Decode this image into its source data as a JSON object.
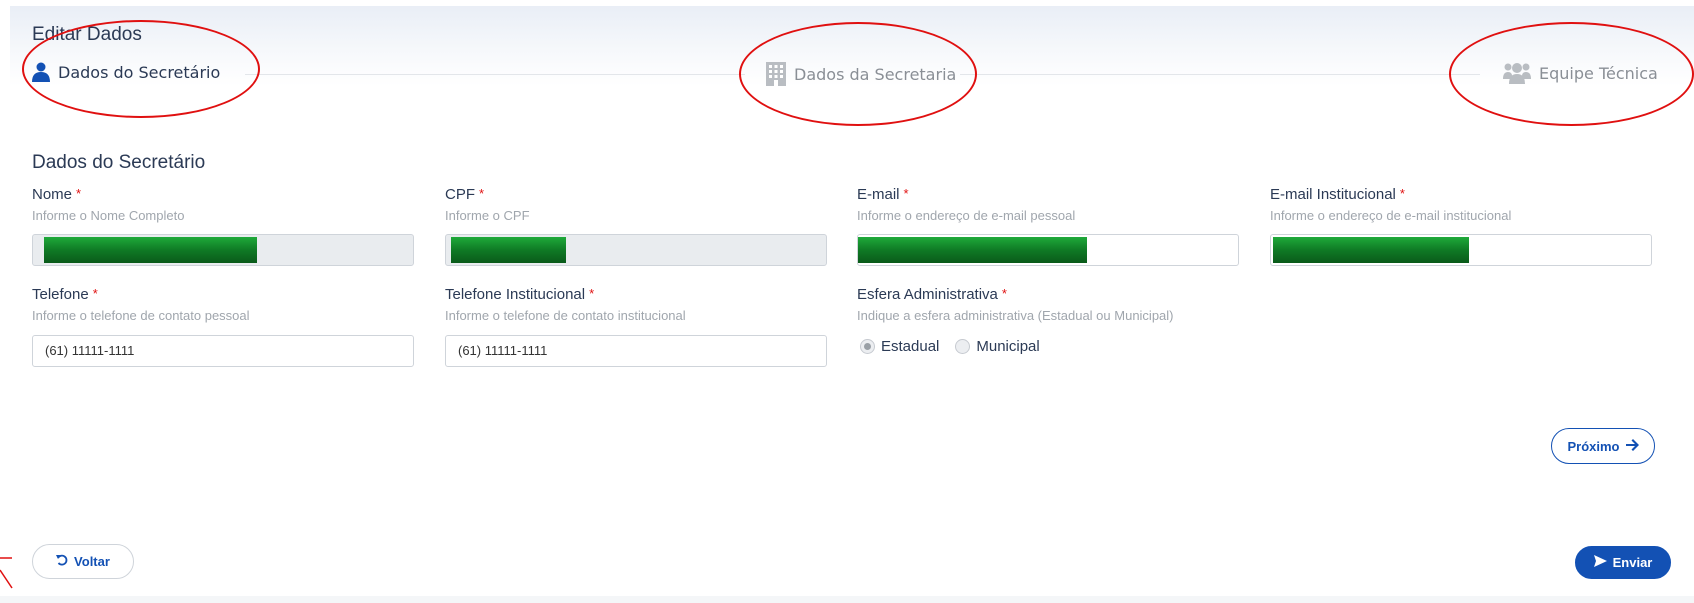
{
  "header": {
    "title": "Editar Dados"
  },
  "steps": [
    {
      "label": "Dados do Secretário",
      "icon": "user-icon",
      "state": "active"
    },
    {
      "label": "Dados da Secretaria",
      "icon": "building-icon",
      "state": "inactive"
    },
    {
      "label": "Equipe Técnica",
      "icon": "users-icon",
      "state": "inactive"
    }
  ],
  "section": {
    "title": "Dados do Secretário"
  },
  "fields": {
    "nome": {
      "label": "Nome",
      "required": "*",
      "hint": "Informe o Nome Completo",
      "value": ""
    },
    "cpf": {
      "label": "CPF",
      "required": "*",
      "hint": "Informe o CPF",
      "value": ""
    },
    "email": {
      "label": "E-mail",
      "required": "*",
      "hint": "Informe o endereço de e-mail pessoal",
      "value": ""
    },
    "email_inst": {
      "label": "E-mail Institucional",
      "required": "*",
      "hint": "Informe o endereço de e-mail institucional",
      "value": ""
    },
    "telefone": {
      "label": "Telefone",
      "required": "*",
      "hint": "Informe o telefone de contato pessoal",
      "value": "(61) 11111-1111"
    },
    "telefone_inst": {
      "label": "Telefone Institucional",
      "required": "*",
      "hint": "Informe o telefone de contato institucional",
      "value": "(61) 11111-1111"
    },
    "esfera": {
      "label": "Esfera Administrativa",
      "required": "*",
      "hint": "Indique a esfera administrativa (Estadual ou Municipal)",
      "options": [
        "Estadual",
        "Municipal"
      ],
      "selected": "Estadual"
    }
  },
  "buttons": {
    "next": "Próximo",
    "back": "Voltar",
    "submit": "Enviar"
  },
  "colors": {
    "primary": "#1351b4",
    "required": "#e01010",
    "annotation": "#e01010",
    "redaction": "#0f7a25"
  }
}
